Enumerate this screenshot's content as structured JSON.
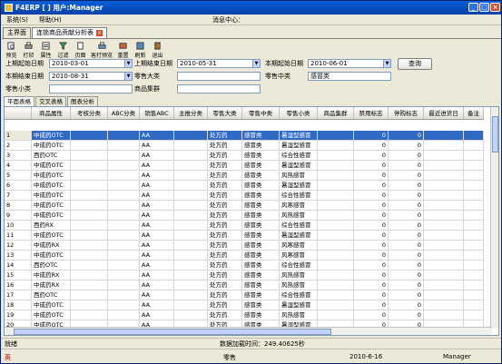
{
  "app": {
    "title": "F4ERP [ ] 用户:Manager"
  },
  "menu": {
    "system": "系统(S)",
    "help": "帮助(H)",
    "message_center": "消息中心："
  },
  "tabs": {
    "main": "主界面",
    "report": "连锁商品贡献分析表"
  },
  "toolbar": {
    "preview": "预览",
    "print": "打印",
    "attr": "属性",
    "filter": "过滤",
    "page": "页面",
    "custom_print": "客打预览",
    "reset": "重置",
    "refresh": "刷新",
    "exit": "退出"
  },
  "filters": {
    "prev_start_label": "上期起始日期",
    "prev_start": "2010-03-01",
    "prev_end_label": "上期结束日期",
    "prev_end": "2010-05-31",
    "cur_start_label": "本期起始日期",
    "cur_start": "2010-06-01",
    "cur_end_label": "本期结束日期",
    "cur_end": "2010-08-31",
    "retail_major_label": "零售大类",
    "retail_major": "",
    "retail_mid_label": "零售中类",
    "retail_mid": "感冒类",
    "retail_minor_label": "零售小类",
    "retail_minor": "",
    "group_label": "商品集群",
    "group": "",
    "query": "查询"
  },
  "subtabs": {
    "flat": "平面表格",
    "cross": "交叉表格",
    "chart": "图表分析"
  },
  "grid": {
    "columns": [
      "",
      "商品属性",
      "考核分类",
      "ABC分类",
      "销售ABC",
      "主推分类",
      "零售大类",
      "零售中类",
      "零售小类",
      "商品集群",
      "禁用标志",
      "停购标志",
      "最近进货日",
      "备注"
    ],
    "rows": [
      [
        "1",
        "中成药OTC",
        "",
        "",
        "AA",
        "",
        "处方药",
        "感冒类",
        "暑湿型感冒",
        "",
        "0",
        "0",
        ""
      ],
      [
        "2",
        "中成药OTC",
        "",
        "",
        "AA",
        "",
        "处方药",
        "感冒类",
        "暑湿型感冒",
        "",
        "0",
        "0",
        ""
      ],
      [
        "3",
        "西药OTC",
        "",
        "",
        "AA",
        "",
        "处方药",
        "感冒类",
        "综合性感冒",
        "",
        "0",
        "0",
        ""
      ],
      [
        "4",
        "中成药OTC",
        "",
        "",
        "AA",
        "",
        "处方药",
        "感冒类",
        "暑湿型感冒",
        "",
        "0",
        "0",
        ""
      ],
      [
        "5",
        "中成药OTC",
        "",
        "",
        "AA",
        "",
        "处方药",
        "感冒类",
        "风热感冒",
        "",
        "0",
        "0",
        ""
      ],
      [
        "6",
        "中成药OTC",
        "",
        "",
        "AA",
        "",
        "处方药",
        "感冒类",
        "暑湿型感冒",
        "",
        "0",
        "0",
        ""
      ],
      [
        "7",
        "中成药OTC",
        "",
        "",
        "AA",
        "",
        "处方药",
        "感冒类",
        "综合性感冒",
        "",
        "0",
        "0",
        ""
      ],
      [
        "8",
        "中成药OTC",
        "",
        "",
        "AA",
        "",
        "处方药",
        "感冒类",
        "风寒感冒",
        "",
        "0",
        "0",
        ""
      ],
      [
        "9",
        "中成药OTC",
        "",
        "",
        "AA",
        "",
        "处方药",
        "感冒类",
        "风热感冒",
        "",
        "0",
        "0",
        ""
      ],
      [
        "10",
        "西药RX",
        "",
        "",
        "AA",
        "",
        "处方药",
        "感冒类",
        "综合性感冒",
        "",
        "0",
        "0",
        ""
      ],
      [
        "11",
        "中成药OTC",
        "",
        "",
        "AA",
        "",
        "处方药",
        "感冒类",
        "暑湿型感冒",
        "",
        "0",
        "0",
        ""
      ],
      [
        "12",
        "中成药RX",
        "",
        "",
        "AA",
        "",
        "处方药",
        "感冒类",
        "风寒感冒",
        "",
        "0",
        "0",
        ""
      ],
      [
        "13",
        "中成药OTC",
        "",
        "",
        "AA",
        "",
        "处方药",
        "感冒类",
        "风寒感冒",
        "",
        "0",
        "0",
        ""
      ],
      [
        "14",
        "西药OTC",
        "",
        "",
        "AA",
        "",
        "处方药",
        "感冒类",
        "综合性感冒",
        "",
        "0",
        "0",
        ""
      ],
      [
        "15",
        "中成药RX",
        "",
        "",
        "AA",
        "",
        "处方药",
        "感冒类",
        "风热感冒",
        "",
        "0",
        "0",
        ""
      ],
      [
        "16",
        "中成药RX",
        "",
        "",
        "AA",
        "",
        "处方药",
        "感冒类",
        "风热感冒",
        "",
        "0",
        "0",
        ""
      ],
      [
        "17",
        "西药OTC",
        "",
        "",
        "AA",
        "",
        "处方药",
        "感冒类",
        "综合性感冒",
        "",
        "0",
        "0",
        ""
      ],
      [
        "18",
        "中成药OTC",
        "",
        "",
        "AA",
        "",
        "处方药",
        "感冒类",
        "暑湿型感冒",
        "",
        "0",
        "0",
        ""
      ],
      [
        "19",
        "中成药OTC",
        "",
        "",
        "AA",
        "",
        "处方药",
        "感冒类",
        "风热感冒",
        "",
        "0",
        "0",
        ""
      ],
      [
        "20",
        "中成药OTC",
        "",
        "",
        "AA",
        "",
        "处方药",
        "感冒类",
        "暑湿型感冒",
        "",
        "0",
        "0",
        ""
      ]
    ]
  },
  "status": {
    "ready": "就绪",
    "load_time": "数据加载时间：249.40625秒",
    "module": "零售",
    "date": "2010-6-16",
    "user": "Manager",
    "ime": "英"
  }
}
